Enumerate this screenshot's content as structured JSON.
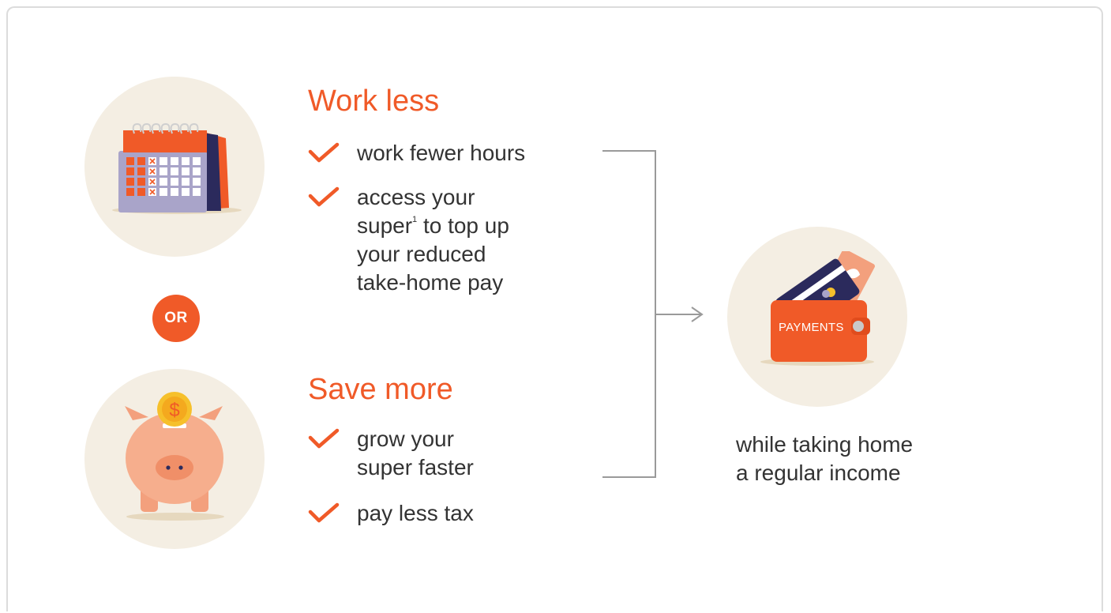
{
  "colors": {
    "accent": "#f05a28",
    "circle_bg": "#f4eee3",
    "text": "#333333",
    "line": "#9a9a9a"
  },
  "or_label": "OR",
  "work_less": {
    "heading": "Work less",
    "items": [
      {
        "text": "work fewer hours"
      },
      {
        "line1": "access your",
        "line2_pre": "super",
        "footnote": "1",
        "line2_post": " to top up",
        "line3": "your reduced",
        "line4": "take-home pay"
      }
    ]
  },
  "save_more": {
    "heading": "Save more",
    "items": [
      {
        "line1": "grow your",
        "line2": "super faster"
      },
      {
        "text": "pay less tax"
      }
    ]
  },
  "result": {
    "line1": "while taking home",
    "line2": "a regular income",
    "wallet_label": "PAYMENTS"
  },
  "icons": [
    "calendar-icon",
    "piggy-bank-icon",
    "wallet-icon",
    "check-icon",
    "arrow-right-icon"
  ]
}
